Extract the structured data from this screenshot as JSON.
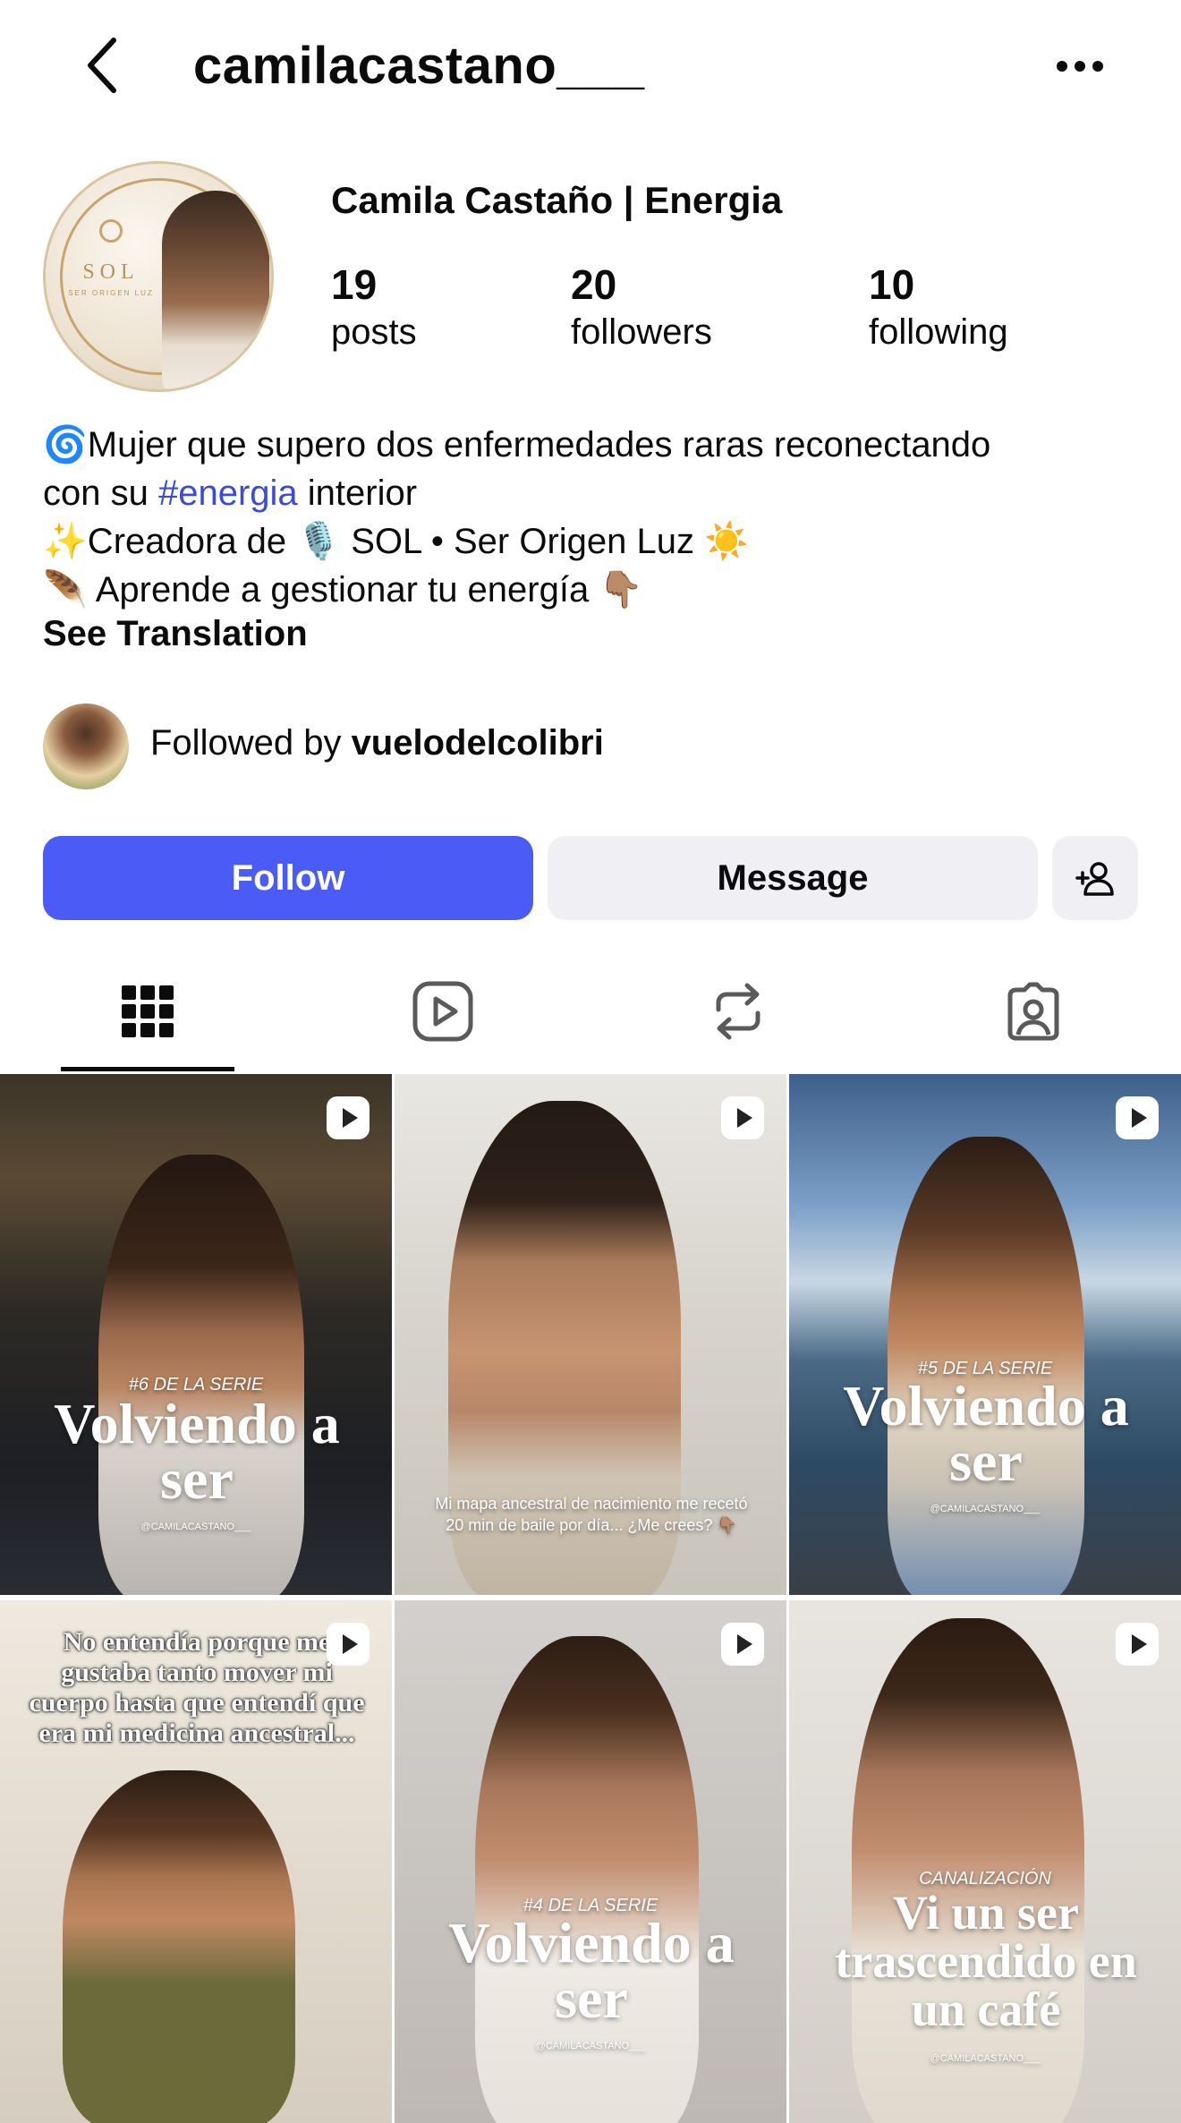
{
  "header": {
    "username": "camilacastano___"
  },
  "profile": {
    "display_name": "Camila Castaño | Energia",
    "avatar_logo_text": "SOL",
    "avatar_logo_subtext": "SER ORIGEN LUZ",
    "stats": [
      {
        "value": "19",
        "label": "posts"
      },
      {
        "value": "20",
        "label": "followers"
      },
      {
        "value": "10",
        "label": "following"
      }
    ],
    "bio": {
      "line1": "🌀Mujer que supero dos enfermedades raras reconectando",
      "line2_pre": "con su ",
      "line2_hashtag": "#energia",
      "line2_post": " interior",
      "line3": "✨Creadora de 🎙️ SOL • Ser Origen Luz ☀️",
      "line4": "🪶 Aprende a gestionar tu energía 👇🏽"
    },
    "see_translation": "See Translation",
    "followed_by_prefix": "Followed by ",
    "followed_by_user": "vuelodelcolibri"
  },
  "actions": {
    "follow": "Follow",
    "message": "Message"
  },
  "tabs": [
    {
      "name": "grid",
      "icon": "grid-icon",
      "active": true
    },
    {
      "name": "reels",
      "icon": "reels-icon",
      "active": false
    },
    {
      "name": "reposts",
      "icon": "repost-icon",
      "active": false
    },
    {
      "name": "tagged",
      "icon": "tagged-icon",
      "active": false
    }
  ],
  "posts": [
    {
      "series": "#6 DE LA SERIE",
      "title": "Volviendo a ser",
      "handle": "@CAMILACASTANO___",
      "caption": ""
    },
    {
      "series": "",
      "title": "",
      "handle": "",
      "caption": "Mi mapa ancestral de nacimiento me recetó 20 min de baile por día... ¿Me crees? 👇🏽"
    },
    {
      "series": "#5 DE LA SERIE",
      "title": "Volviendo a ser",
      "handle": "@CAMILACASTANO___",
      "caption": ""
    },
    {
      "series": "",
      "title": "",
      "handle": "",
      "caption": "No entendía porque me gustaba tanto mover mi cuerpo hasta que entendí que era mi medicina ancestral..."
    },
    {
      "series": "#4 DE LA SERIE",
      "title": "Volviendo a ser",
      "handle": "@CAMILACASTANO___",
      "caption": ""
    },
    {
      "series": "CANALIZACIÓN",
      "title": "Vi un ser trascendido en un café",
      "handle": "@CAMILACASTANO___",
      "caption": ""
    }
  ]
}
